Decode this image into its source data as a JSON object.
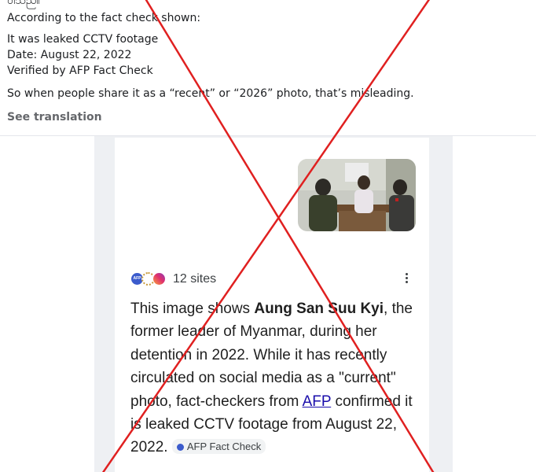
{
  "post": {
    "lines": [
      "ဝါသည်။",
      "According to the fact check shown:",
      "It was leaked CCTV footage",
      "Date: August 22, 2022",
      "Verified by AFP Fact Check",
      "So when people share it as a “recent” or “2026” photo, that’s misleading."
    ],
    "see_translation": "See translation"
  },
  "card": {
    "sites_count": "12 sites",
    "logos": [
      "afp-logo",
      "sun-logo",
      "instagram-logo"
    ],
    "afp_logo_text": "AFP",
    "text_1": "This image shows ",
    "subject": "Aung San Suu Kyi",
    "text_2": ", the former leader of Myanmar, during her detention in 2022. While it has recently circulated on social media as a \"current\" photo, fact-checkers from ",
    "source_link": "AFP",
    "text_3": " confirmed it is leaked CCTV footage from August 22, 2022. ",
    "chip_label": "AFP Fact Check"
  },
  "colors": {
    "overlay_x": "#e02020",
    "link": "#1a0dab",
    "muted": "#65676b"
  }
}
